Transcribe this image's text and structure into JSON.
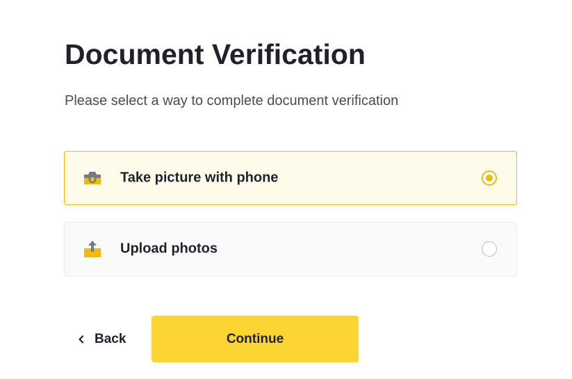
{
  "header": {
    "title": "Document Verification",
    "subtitle": "Please select a way to complete document verification"
  },
  "options": [
    {
      "label": "Take picture with phone",
      "icon": "camera-icon",
      "selected": true
    },
    {
      "label": "Upload photos",
      "icon": "upload-icon",
      "selected": false
    }
  ],
  "actions": {
    "back_label": "Back",
    "continue_label": "Continue"
  },
  "colors": {
    "accent": "#f0b90b",
    "button_primary": "#fcd535",
    "selected_bg": "#fefbeb",
    "text_primary": "#1e2329",
    "text_secondary": "#474d57"
  }
}
